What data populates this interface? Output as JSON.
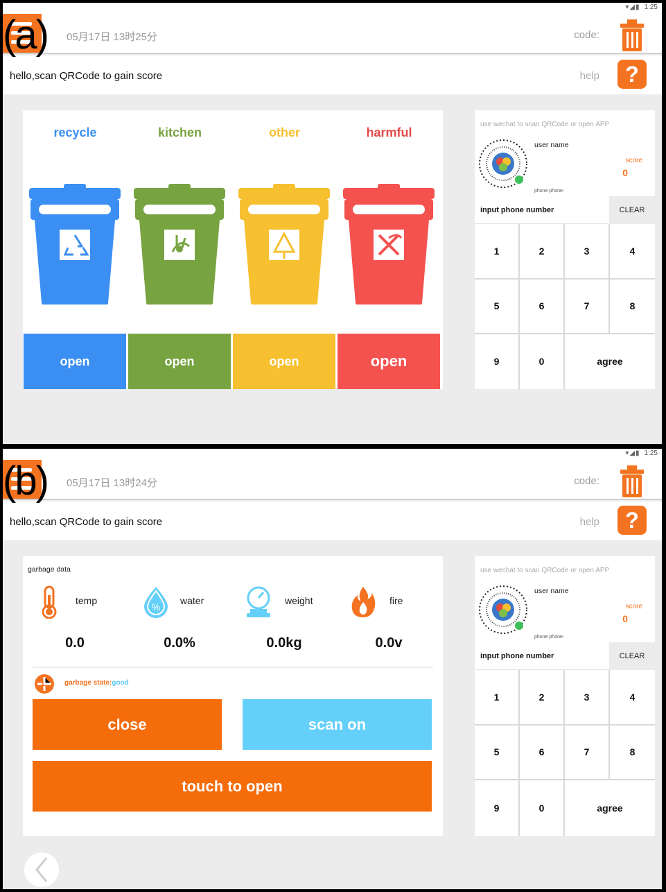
{
  "panel_a": {
    "label": "(a)",
    "status_time": "1:25",
    "datetime": "05月17日 13时25分",
    "code_label": "code:",
    "greeting": "hello,scan QRCode to gain score",
    "help_label": "help",
    "help_icon": "?",
    "bins": [
      {
        "title": "recycle",
        "button": "open",
        "color": "#3b8ff2",
        "title_color": "#3b8ff2",
        "icon": "recycle-icon"
      },
      {
        "title": "kitchen",
        "button": "open",
        "color": "#77a340",
        "title_color": "#77a340",
        "icon": "fishbone-icon"
      },
      {
        "title": "other",
        "button": "open",
        "color": "#f6c030",
        "title_color": "#f6c030",
        "icon": "other-waste-icon"
      },
      {
        "title": "harmful",
        "button": "open",
        "color": "#f4524f",
        "title_color": "#e34a4a",
        "icon": "harmful-icon"
      }
    ],
    "right": {
      "hint": "use wechat to scan QRCode or open APP",
      "username": "user name",
      "score_label": "score",
      "score": "0",
      "phone_label": "phone phone:",
      "input_placeholder": "input phone number",
      "clear": "CLEAR",
      "keys": [
        "1",
        "2",
        "3",
        "4",
        "5",
        "6",
        "7",
        "8",
        "9",
        "0",
        "agree"
      ]
    }
  },
  "panel_b": {
    "label": "(b)",
    "status_time": "1:25",
    "datetime": "05月17日 13时24分",
    "code_label": "code:",
    "greeting": "hello,scan QRCode to gain score",
    "help_label": "help",
    "help_icon": "?",
    "garbage_data_title": "garbage data",
    "sensors": [
      {
        "name": "temp",
        "value": "0.0",
        "icon": "thermometer-icon"
      },
      {
        "name": "water",
        "value": "0.0%",
        "icon": "water-drop-icon"
      },
      {
        "name": "weight",
        "value": "0.0kg",
        "icon": "scale-icon"
      },
      {
        "name": "fire",
        "value": "0.0v",
        "icon": "fire-icon"
      }
    ],
    "state_label": "garbage state:",
    "state_value": "good",
    "buttons": {
      "close": "close",
      "scan_on": "scan on",
      "touch_to_open": "touch to open"
    },
    "right": {
      "hint": "use wechat to scan QRCode or open APP",
      "username": "user name",
      "score_label": "score",
      "score": "0",
      "phone_label": "phone phone:",
      "input_placeholder": "input phone number",
      "clear": "CLEAR",
      "keys": [
        "1",
        "2",
        "3",
        "4",
        "5",
        "6",
        "7",
        "8",
        "9",
        "0",
        "agree"
      ]
    }
  },
  "colors": {
    "accent": "#f37321",
    "sky": "#64cff8",
    "background": "#ececec"
  }
}
